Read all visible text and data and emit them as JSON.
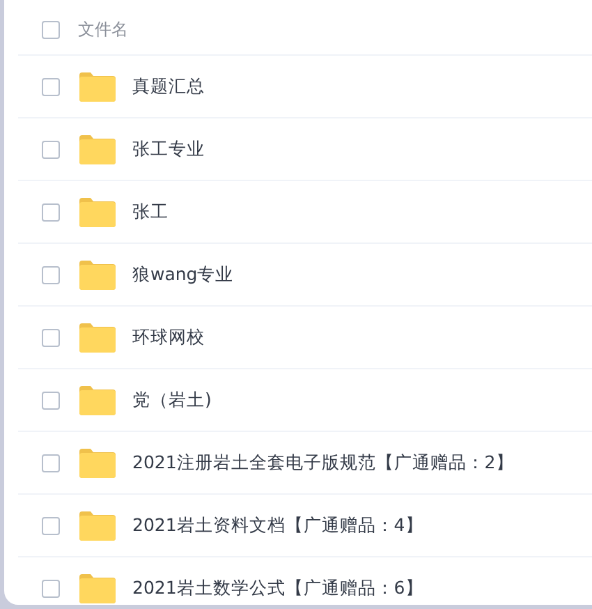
{
  "header": {
    "checked": false,
    "label": "文件名"
  },
  "files": [
    {
      "name": "真题汇总",
      "checked": false
    },
    {
      "name": "张工专业",
      "checked": false
    },
    {
      "name": "张工",
      "checked": false
    },
    {
      "name": "狼wang专业",
      "checked": false
    },
    {
      "name": "环球网校",
      "checked": false
    },
    {
      "name": "党（岩土)",
      "checked": false
    },
    {
      "name": "2021注册岩土全套电子版规范【广通赠品：2】",
      "checked": false
    },
    {
      "name": "2021岩土资料文档【广通赠品：4】",
      "checked": false
    },
    {
      "name": "2021岩土数学公式【广通赠品：6】",
      "checked": false
    }
  ]
}
